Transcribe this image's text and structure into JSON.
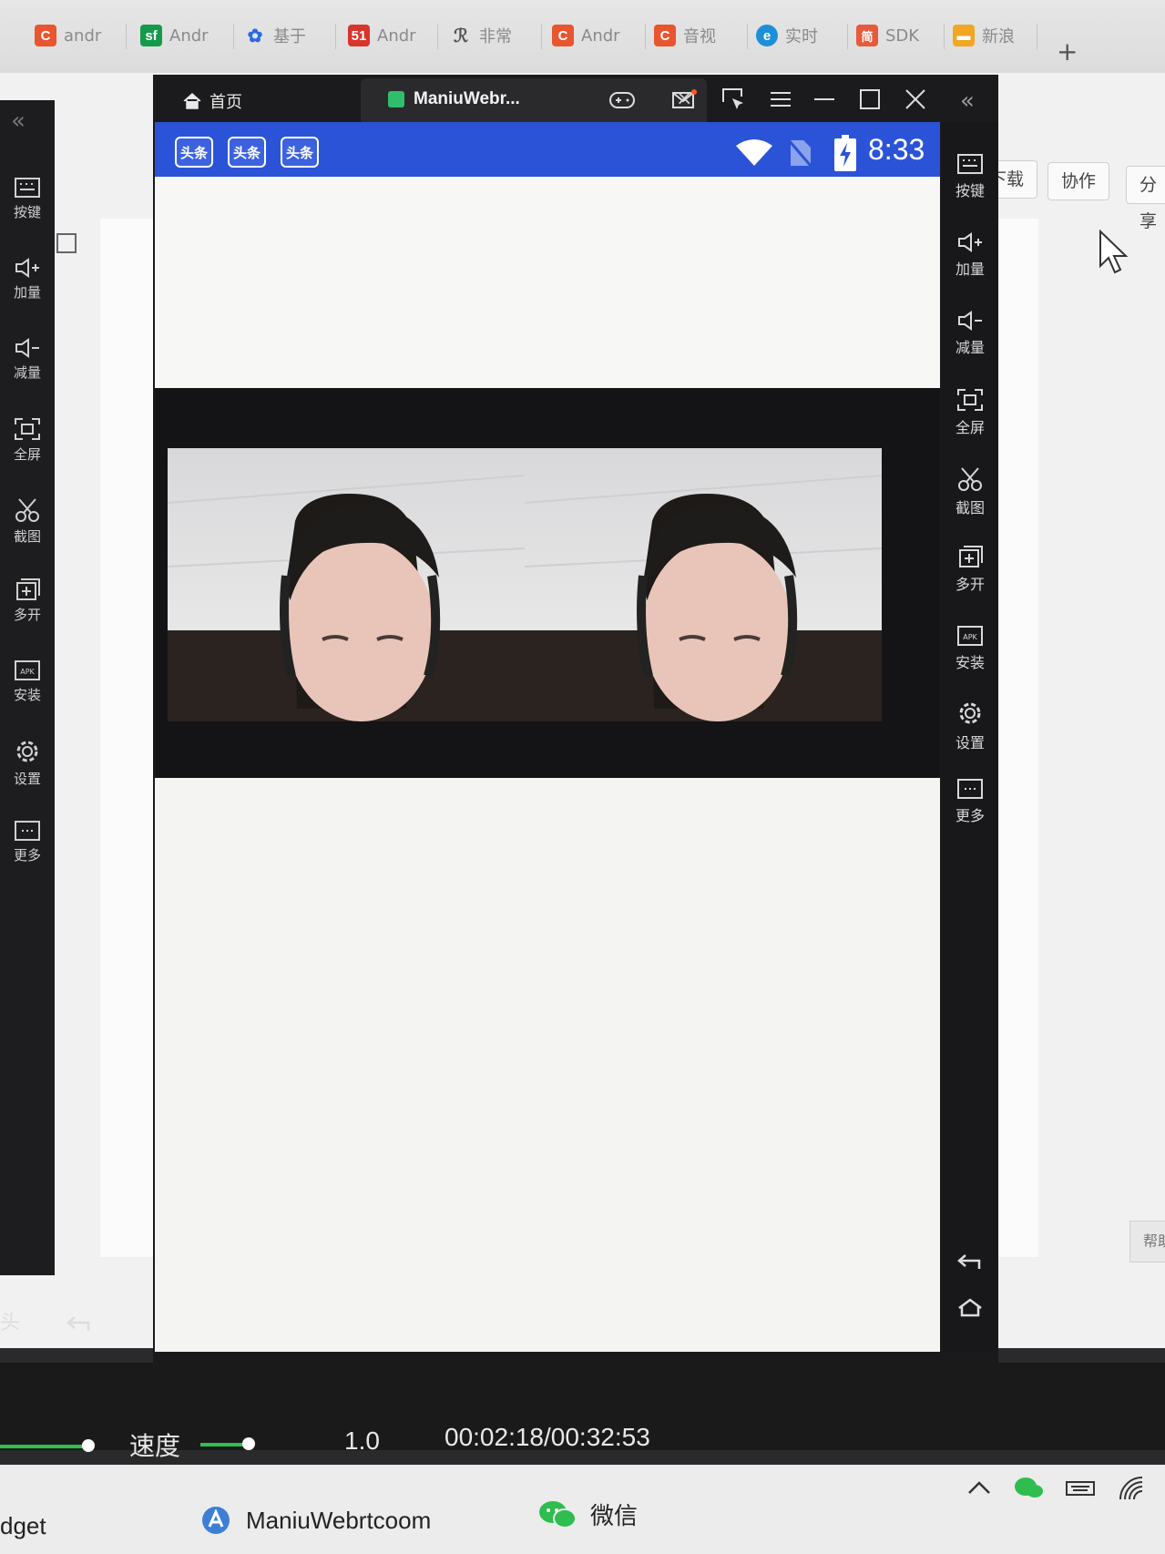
{
  "browser": {
    "tabs": [
      {
        "label": "andr",
        "icon": "C",
        "color": "#e8552f"
      },
      {
        "label": "Andr",
        "icon": "sf",
        "color": "#159a4a"
      },
      {
        "label": "基于",
        "icon": "paw-icon",
        "color": "#2a6be0"
      },
      {
        "label": "Andr",
        "icon": "51",
        "color": "#d8352b"
      },
      {
        "label": "非常",
        "icon": "ninja-icon",
        "color": "#555555"
      },
      {
        "label": "Andr",
        "icon": "C",
        "color": "#e8552f"
      },
      {
        "label": "音视",
        "icon": "C",
        "color": "#e8552f"
      },
      {
        "label": "实时",
        "icon": "edge-icon",
        "color": "#1d8fd8"
      },
      {
        "label": "SDK",
        "icon": "简",
        "color": "#e55a3a"
      },
      {
        "label": "新浪",
        "icon": "folder-icon",
        "color": "#f2a623"
      }
    ],
    "new_tab": "+"
  },
  "doc": {
    "download_label": "下载",
    "collab_label": "协作",
    "share_label": "分享",
    "help_label": "帮助"
  },
  "left_sidebar": {
    "collapse": "«",
    "items": [
      {
        "label": "按键",
        "icon": "keyboard-icon"
      },
      {
        "label": "加量",
        "icon": "volume-up-icon"
      },
      {
        "label": "减量",
        "icon": "volume-down-icon"
      },
      {
        "label": "全屏",
        "icon": "fullscreen-icon"
      },
      {
        "label": "截图",
        "icon": "scissors-icon"
      },
      {
        "label": "多开",
        "icon": "multi-open-icon"
      },
      {
        "label": "安装",
        "icon": "apk-icon"
      },
      {
        "label": "设置",
        "icon": "gear-icon"
      },
      {
        "label": "更多",
        "icon": "more-icon"
      }
    ],
    "bottom_text": "头"
  },
  "emulator": {
    "home_label": "首页",
    "app_tab_label": "ManiuWebr...",
    "app_tab_close": "×",
    "controls": [
      "gamepad-icon",
      "mail-icon",
      "cursor-box-icon",
      "menu-icon",
      "minimize-icon",
      "maximize-icon",
      "close-icon"
    ],
    "collapse": "«"
  },
  "android": {
    "notifications": [
      "头条",
      "头条",
      "头条"
    ],
    "time": "8:33",
    "status_icons": [
      "wifi-icon",
      "no-sim-icon",
      "battery-charging-icon"
    ],
    "colors": {
      "statusbar": "#2b53d8"
    }
  },
  "right_sidebar": {
    "items": [
      {
        "label": "按键",
        "icon": "keyboard-icon"
      },
      {
        "label": "加量",
        "icon": "volume-up-icon"
      },
      {
        "label": "减量",
        "icon": "volume-down-icon"
      },
      {
        "label": "全屏",
        "icon": "fullscreen-icon"
      },
      {
        "label": "截图",
        "icon": "scissors-icon"
      },
      {
        "label": "多开",
        "icon": "multi-open-icon"
      },
      {
        "label": "安装",
        "icon": "apk-icon"
      },
      {
        "label": "设置",
        "icon": "gear-icon"
      },
      {
        "label": "更多",
        "icon": "more-icon"
      }
    ]
  },
  "player": {
    "speed_label": "速度",
    "speed_value": "1.0",
    "timecode": "00:02:18/00:32:53"
  },
  "taskbar": {
    "partial_left": "dget",
    "app1": "ManiuWebrtcoom",
    "app2": "微信",
    "tray_icons": [
      "chevron-up-icon",
      "wechat-tray-icon",
      "keyboard-tray-icon",
      "network-icon"
    ]
  }
}
